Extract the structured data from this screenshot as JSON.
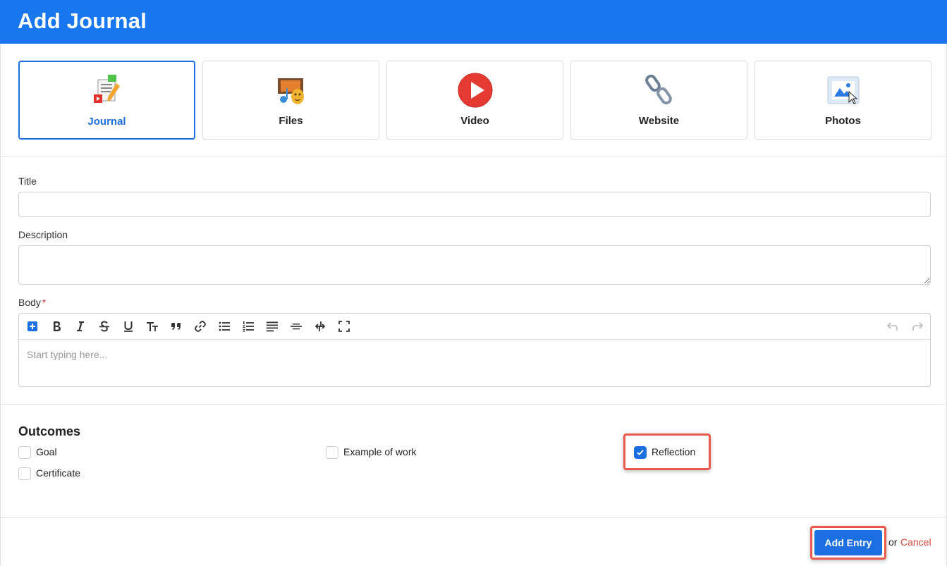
{
  "header": {
    "title": "Add Journal"
  },
  "types": [
    {
      "label": "Journal",
      "icon": "journal-icon",
      "active": true
    },
    {
      "label": "Files",
      "icon": "files-icon",
      "active": false
    },
    {
      "label": "Video",
      "icon": "video-play-icon",
      "active": false
    },
    {
      "label": "Website",
      "icon": "link-icon",
      "active": false
    },
    {
      "label": "Photos",
      "icon": "photo-icon",
      "active": false
    }
  ],
  "form": {
    "title_label": "Title",
    "title_value": "",
    "description_label": "Description",
    "description_value": "",
    "body_label": "Body",
    "body_required_mark": "*",
    "body_placeholder": "Start typing here..."
  },
  "toolbar_icons": [
    "insert-icon",
    "bold-icon",
    "italic-icon",
    "strikethrough-icon",
    "underline-icon",
    "text-size-icon",
    "quote-icon",
    "link-icon",
    "bullet-list-icon",
    "numbered-list-icon",
    "align-icon",
    "horizontal-rule-icon",
    "indent-icon",
    "fullscreen-icon",
    "undo-icon",
    "redo-icon"
  ],
  "outcomes": {
    "title": "Outcomes",
    "items": [
      {
        "label": "Goal",
        "checked": false
      },
      {
        "label": "Example of work",
        "checked": false
      },
      {
        "label": "Reflection",
        "checked": true
      },
      {
        "label": "Certificate",
        "checked": false
      }
    ]
  },
  "actions": {
    "add_label": "Add Entry",
    "or_text": "or",
    "cancel_label": "Cancel"
  },
  "colors": {
    "header": "#1877ee",
    "primary": "#1c6fe0",
    "highlight": "#e8584c",
    "cancel": "#d9453b"
  }
}
